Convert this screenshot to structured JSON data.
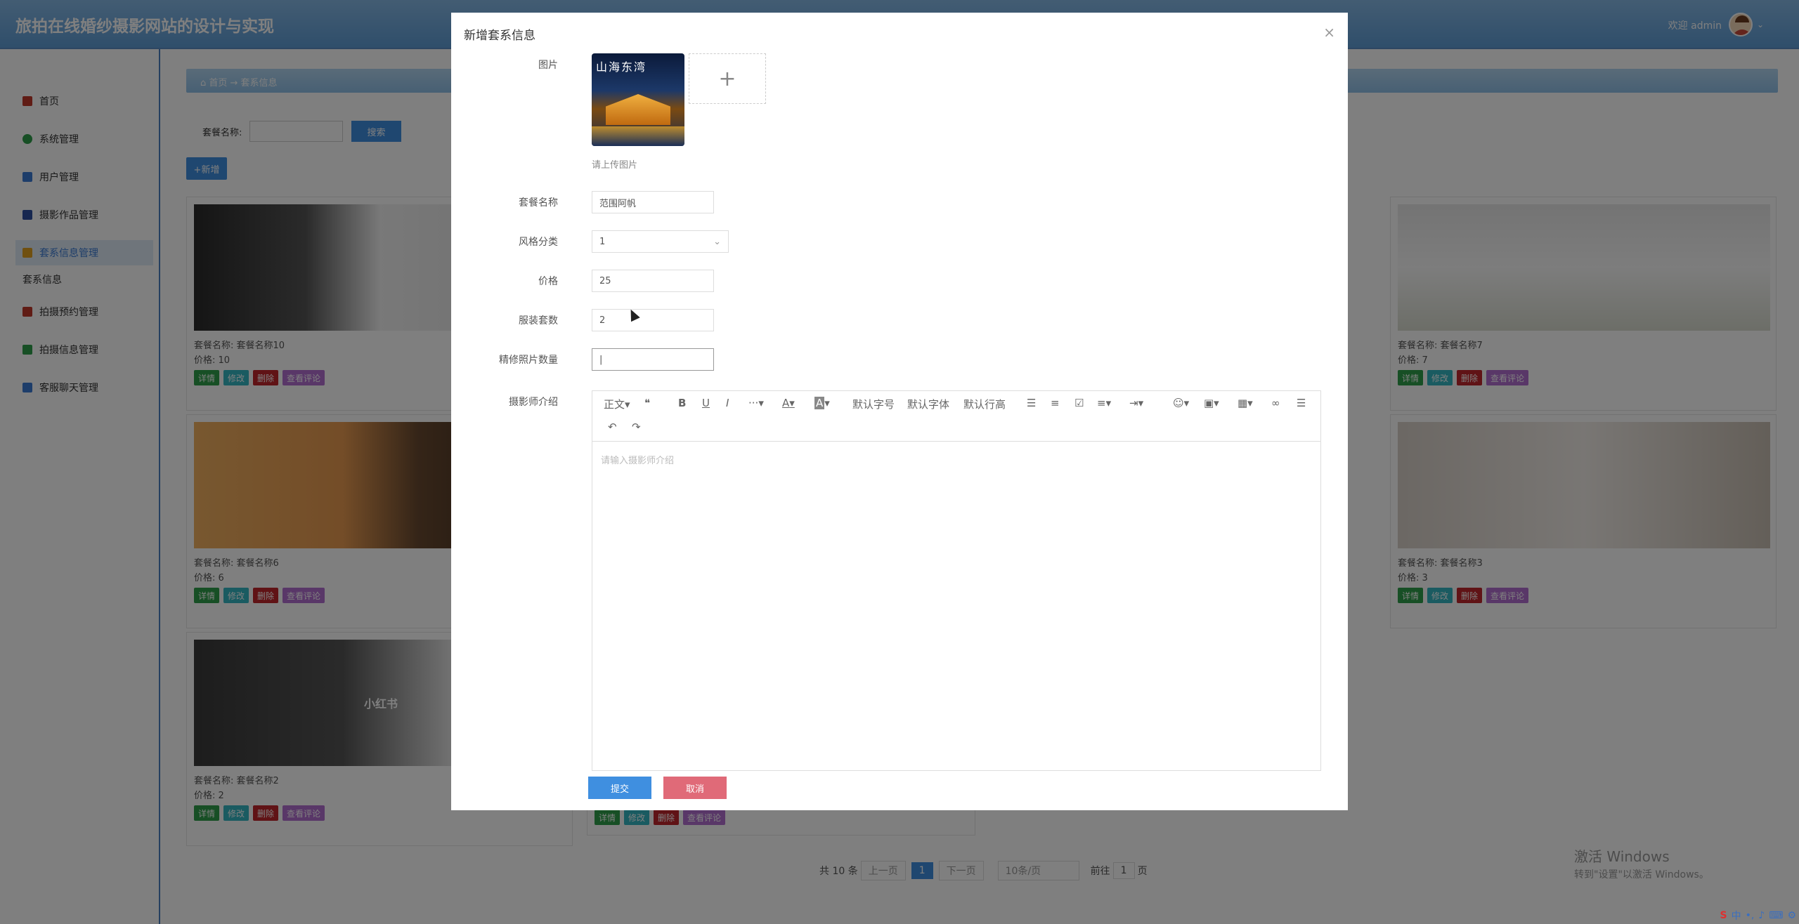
{
  "header": {
    "title": "旅拍在线婚纱摄影网站的设计与实现",
    "welcome": "欢迎 admin"
  },
  "sidebar": {
    "items": [
      {
        "label": "首页",
        "icon": "home-icon",
        "color": "#c0392b"
      },
      {
        "label": "系统管理",
        "icon": "system-icon",
        "color": "#2e9e4a"
      },
      {
        "label": "用户管理",
        "icon": "user-icon",
        "color": "#3a7bd5"
      },
      {
        "label": "摄影作品管理",
        "icon": "camera-icon",
        "color": "#2c4fa0"
      },
      {
        "label": "套系信息管理",
        "icon": "package-icon",
        "color": "#e0a020"
      }
    ],
    "section": "套系信息",
    "items2": [
      {
        "label": "拍摄预约管理",
        "icon": "calendar-icon",
        "color": "#c0392b"
      },
      {
        "label": "拍摄信息管理",
        "icon": "grid-icon",
        "color": "#2e9e4a"
      },
      {
        "label": "客服聊天管理",
        "icon": "chat-icon",
        "color": "#3a7bd5"
      }
    ]
  },
  "breadcrumb": "⌂ 首页 → 套系信息",
  "search": {
    "label": "套餐名称:",
    "button": "搜索"
  },
  "add_button": "+新增",
  "cards": [
    {
      "name": "套餐名称:  套餐名称10",
      "price": "价格:  10"
    },
    {
      "name": "套餐名称:  套餐名称7",
      "price": "价格:  7"
    },
    {
      "name": "套餐名称:  套餐名称6",
      "price": "价格:  6"
    },
    {
      "name": "套餐名称:  套餐名称3",
      "price": "价格:  3"
    },
    {
      "name": "套餐名称:  套餐名称2",
      "price": "价格:  2"
    }
  ],
  "card_buttons": {
    "detail": "详情",
    "edit": "修改",
    "delete": "删除",
    "comments": "查看评论"
  },
  "card_watermark": "小红书",
  "pagination": {
    "total": "共 10 条",
    "prev": "上一页",
    "current": "1",
    "next": "下一页",
    "page_size": "10条/页",
    "goto": "前往",
    "goto_value": "1",
    "page_unit": "页"
  },
  "windows_watermark": {
    "line1": "激活 Windows",
    "line2": "转到\"设置\"以激活 Windows。"
  },
  "modal": {
    "title": "新增套系信息",
    "close": "×",
    "image_label": "图片",
    "thumb_text": "山海东湾",
    "upload_hint": "请上传图片",
    "fields": [
      {
        "label": "套餐名称",
        "value": "范围阿帆"
      },
      {
        "label": "风格分类",
        "value": "1"
      },
      {
        "label": "价格",
        "value": "25"
      },
      {
        "label": "服装套数",
        "value": "2"
      },
      {
        "label": "精修照片数量",
        "value": "|"
      }
    ],
    "editor_label": "摄影师介绍",
    "editor_placeholder": "请输入摄影师介绍",
    "toolbar": {
      "heading": "正文",
      "quote": "❝",
      "bold": "B",
      "underline": "U",
      "italic": "I",
      "more": "···",
      "font_color": "A",
      "bg_color": "A",
      "font_size": "默认字号",
      "font_family": "默认字体",
      "line_height": "默认行高",
      "undo": "↶",
      "redo": "↷"
    },
    "submit": "提交",
    "cancel": "取消"
  }
}
